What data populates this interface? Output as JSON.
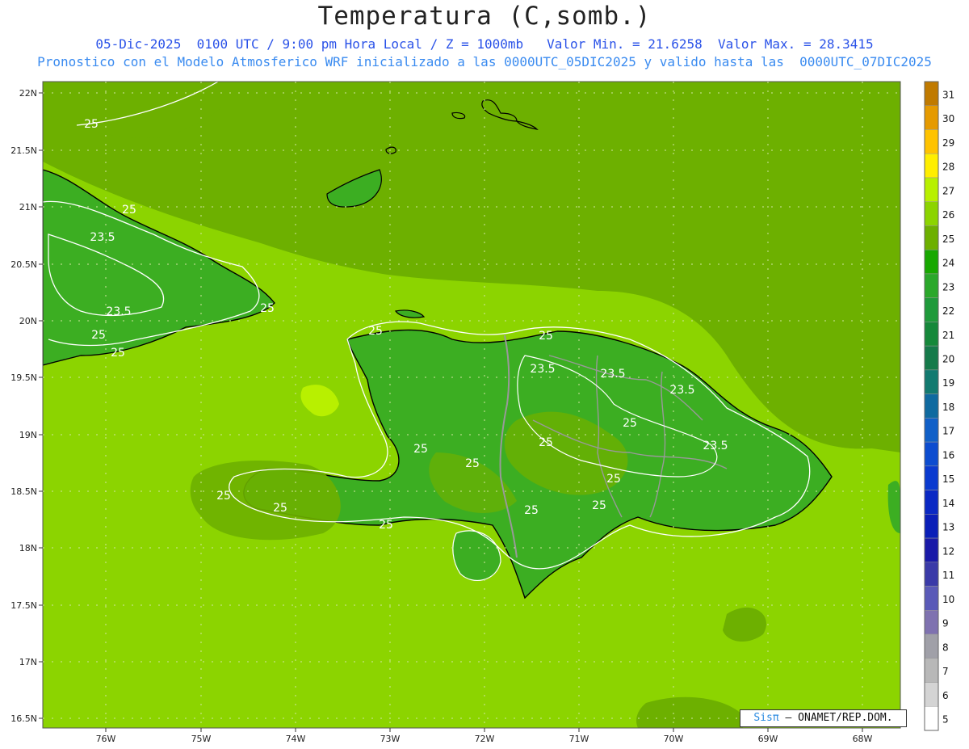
{
  "title": "Temperatura (C,somb.)",
  "subtitle1": "05-Dic-2025  0100 UTC / 9:00 pm Hora Local / Z = 1000mb   Valor Min. = 21.6258  Valor Max. = 28.3415",
  "subtitle2": "Pronostico con el Modelo Atmosferico WRF inicializado a las 0000UTC_05DIC2025 y valido hasta las  0000UTC_07DIC2025",
  "credit": {
    "brand": "Sisπ",
    "text": " – ONAMET/REP.DOM."
  },
  "lat_ticks": [
    "22N",
    "21.5N",
    "21N",
    "20.5N",
    "20N",
    "19.5N",
    "19N",
    "18.5N",
    "18N",
    "17.5N",
    "17N",
    "16.5N"
  ],
  "lon_ticks": [
    "76W",
    "75W",
    "74W",
    "73W",
    "72W",
    "71W",
    "70W",
    "69W",
    "68W"
  ],
  "colorbar": {
    "labels": [
      "31",
      "30",
      "29",
      "28",
      "27",
      "26",
      "25",
      "24",
      "23",
      "22",
      "21",
      "20",
      "19",
      "18",
      "17",
      "16",
      "15",
      "14",
      "13",
      "12",
      "11",
      "10",
      "9",
      "8",
      "7",
      "6",
      "5"
    ],
    "colors": [
      "#c07a00",
      "#e59a00",
      "#ffc300",
      "#ffee00",
      "#b8f000",
      "#8cd400",
      "#6db000",
      "#17a800",
      "#2aa82a",
      "#1e9a3a",
      "#15883a",
      "#157a4a",
      "#127a70",
      "#0f6aa0",
      "#1060c8",
      "#0c4cd0",
      "#0a3ad0",
      "#0a28c4",
      "#0a1eb8",
      "#1a1aa8",
      "#3a3aa8",
      "#5a5ab8",
      "#7f72b0",
      "#a0a0a8",
      "#b8b8b8",
      "#d4d4d4",
      "#ffffff"
    ]
  },
  "contour_labels": [
    "25",
    "25",
    "23.5",
    "23.5",
    "25",
    "25",
    "25",
    "25",
    "25",
    "23.5",
    "23.5",
    "25",
    "23.5",
    "23.5",
    "25",
    "25",
    "25",
    "25",
    "25",
    "25",
    "25",
    "25",
    "25"
  ],
  "colors": {
    "sea": "#8cd400",
    "land": "#3cae22",
    "highland": "#6db000",
    "contour": "#ffffff",
    "coast": "#000000",
    "border": "#999999"
  }
}
